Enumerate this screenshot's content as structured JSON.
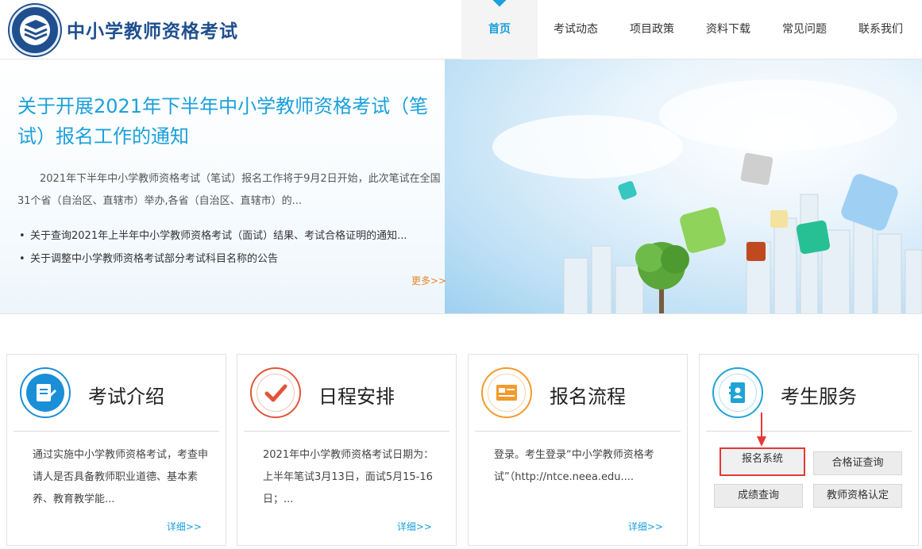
{
  "header": {
    "site_title": "中小学教师资格考试",
    "nav": [
      "首页",
      "考试动态",
      "项目政策",
      "资料下载",
      "常见问题",
      "联系我们"
    ],
    "active_index": 0,
    "accent_color": "#1aa0dc",
    "brand_color": "#1f4f8e"
  },
  "banner": {
    "title": "关于开展2021年下半年中小学教师资格考试（笔试）报名工作的通知",
    "description": "2021年下半年中小学教师资格考试（笔试）报名工作将于9月2日开始，此次笔试在全国31个省（自治区、直辖市）举办,各省（自治区、直辖市）的...",
    "news": [
      "关于查询2021年上半年中小学教师资格考试（面试）结果、考试合格证明的通知...",
      "关于调整中小学教师资格考试部分考试科目名称的公告"
    ],
    "more": "更多>>"
  },
  "cards": [
    {
      "title": "考试介绍",
      "icon": "document-edit-icon",
      "color": "#1a8fd8",
      "text": "通过实施中小学教师资格考试，考查申请人是否具备教师职业道德、基本素养、教育教学能...",
      "more": "详细>>"
    },
    {
      "title": "日程安排",
      "icon": "checkmark-icon",
      "color": "#e2543a",
      "text": "2021年中小学教师资格考试日期为：上半年笔试3月13日，面试5月15-16日；...",
      "more": "详细>>"
    },
    {
      "title": "报名流程",
      "icon": "form-icon",
      "color": "#f39a2b",
      "text": "登录。考生登录“中小学教师资格考试”（http://ntce.neea.edu....",
      "more": "详细>>"
    },
    {
      "title": "考生服务",
      "icon": "contact-book-icon",
      "color": "#1fa3d6",
      "buttons": [
        "报名系统",
        "合格证查询",
        "成绩查询",
        "教师资格认定"
      ]
    }
  ]
}
